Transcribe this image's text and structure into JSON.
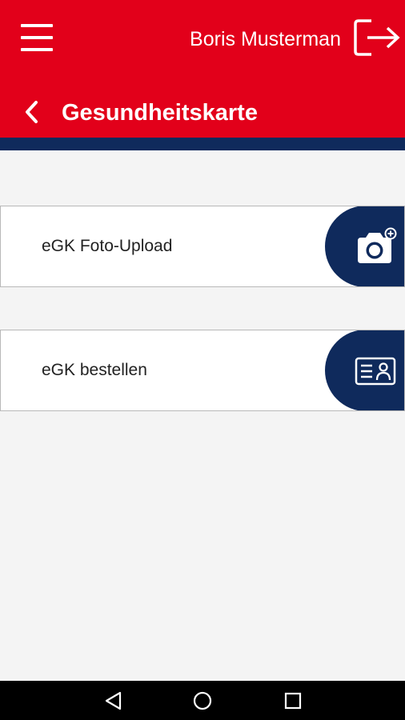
{
  "header": {
    "user_name": "Boris Musterman",
    "page_title": "Gesundheitskarte",
    "menu_icon": "hamburger-menu-icon",
    "logout_icon": "logout-icon",
    "back_icon": "chevron-left-icon"
  },
  "cards": [
    {
      "label": "eGK Foto-Upload",
      "icon": "camera-plus-icon"
    },
    {
      "label": "eGK bestellen",
      "icon": "id-card-icon"
    }
  ],
  "navbar": {
    "items": [
      "back-triangle-icon",
      "home-circle-icon",
      "recents-square-icon"
    ]
  },
  "colors": {
    "brand_red": "#e2001a",
    "brand_navy": "#0f2a5c",
    "background": "#f4f4f4"
  }
}
